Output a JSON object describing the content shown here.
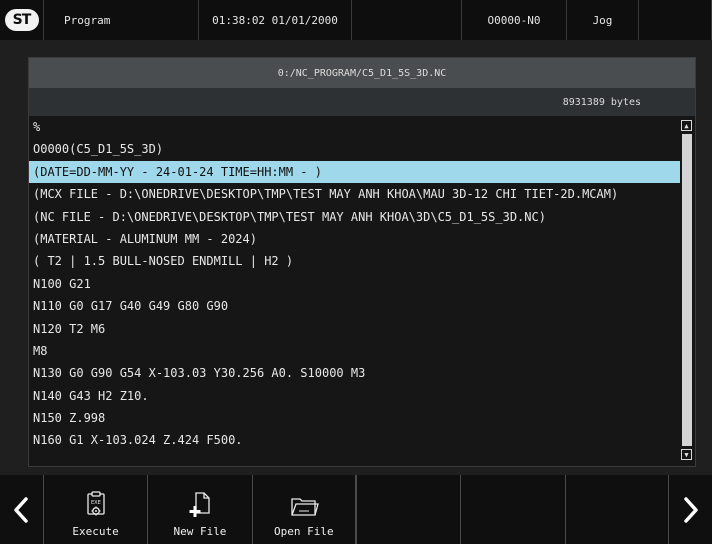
{
  "topbar": {
    "logo_text": "ST",
    "mode": "Program",
    "datetime": "01:38:02 01/01/2000",
    "program_number": "O0000-N0",
    "jog_mode": "Jog"
  },
  "file": {
    "path": "0:/NC_PROGRAM/C5_D1_5S_3D.NC",
    "size": "8931389 bytes"
  },
  "code_lines": [
    "%",
    "O0000(C5_D1_5S_3D)",
    "(DATE=DD-MM-YY - 24-01-24 TIME=HH:MM - )",
    "(MCX FILE - D:\\ONEDRIVE\\DESKTOP\\TMP\\TEST MAY ANH KHOA\\MAU 3D-12 CHI TIET-2D.MCAM)",
    "(NC FILE - D:\\ONEDRIVE\\DESKTOP\\TMP\\TEST MAY ANH KHOA\\3D\\C5_D1_5S_3D.NC)",
    "(MATERIAL - ALUMINUM MM - 2024)",
    "( T2 | 1.5 BULL-NOSED ENDMILL | H2 )",
    "N100 G21",
    "N110 G0 G17 G40 G49 G80 G90",
    "N120 T2 M6",
    "M8",
    "N130 G0 G90 G54 X-103.03 Y30.256 A0. S10000 M3",
    "N140 G43 H2 Z10.",
    "N150 Z.998",
    "N160 G1 X-103.024 Z.424 F500."
  ],
  "selected_line": 2,
  "softkeys": {
    "execute": "Execute",
    "new_file": "New File",
    "open_file": "Open File"
  },
  "colors": {
    "accent_jog": "#f0b429",
    "selection": "#9fd8ea"
  },
  "icons": {
    "prev": "chevron-left-icon",
    "next": "chevron-right-icon",
    "execute": "clipboard-gear-icon",
    "new_file": "file-plus-icon",
    "open_file": "folder-open-icon"
  }
}
